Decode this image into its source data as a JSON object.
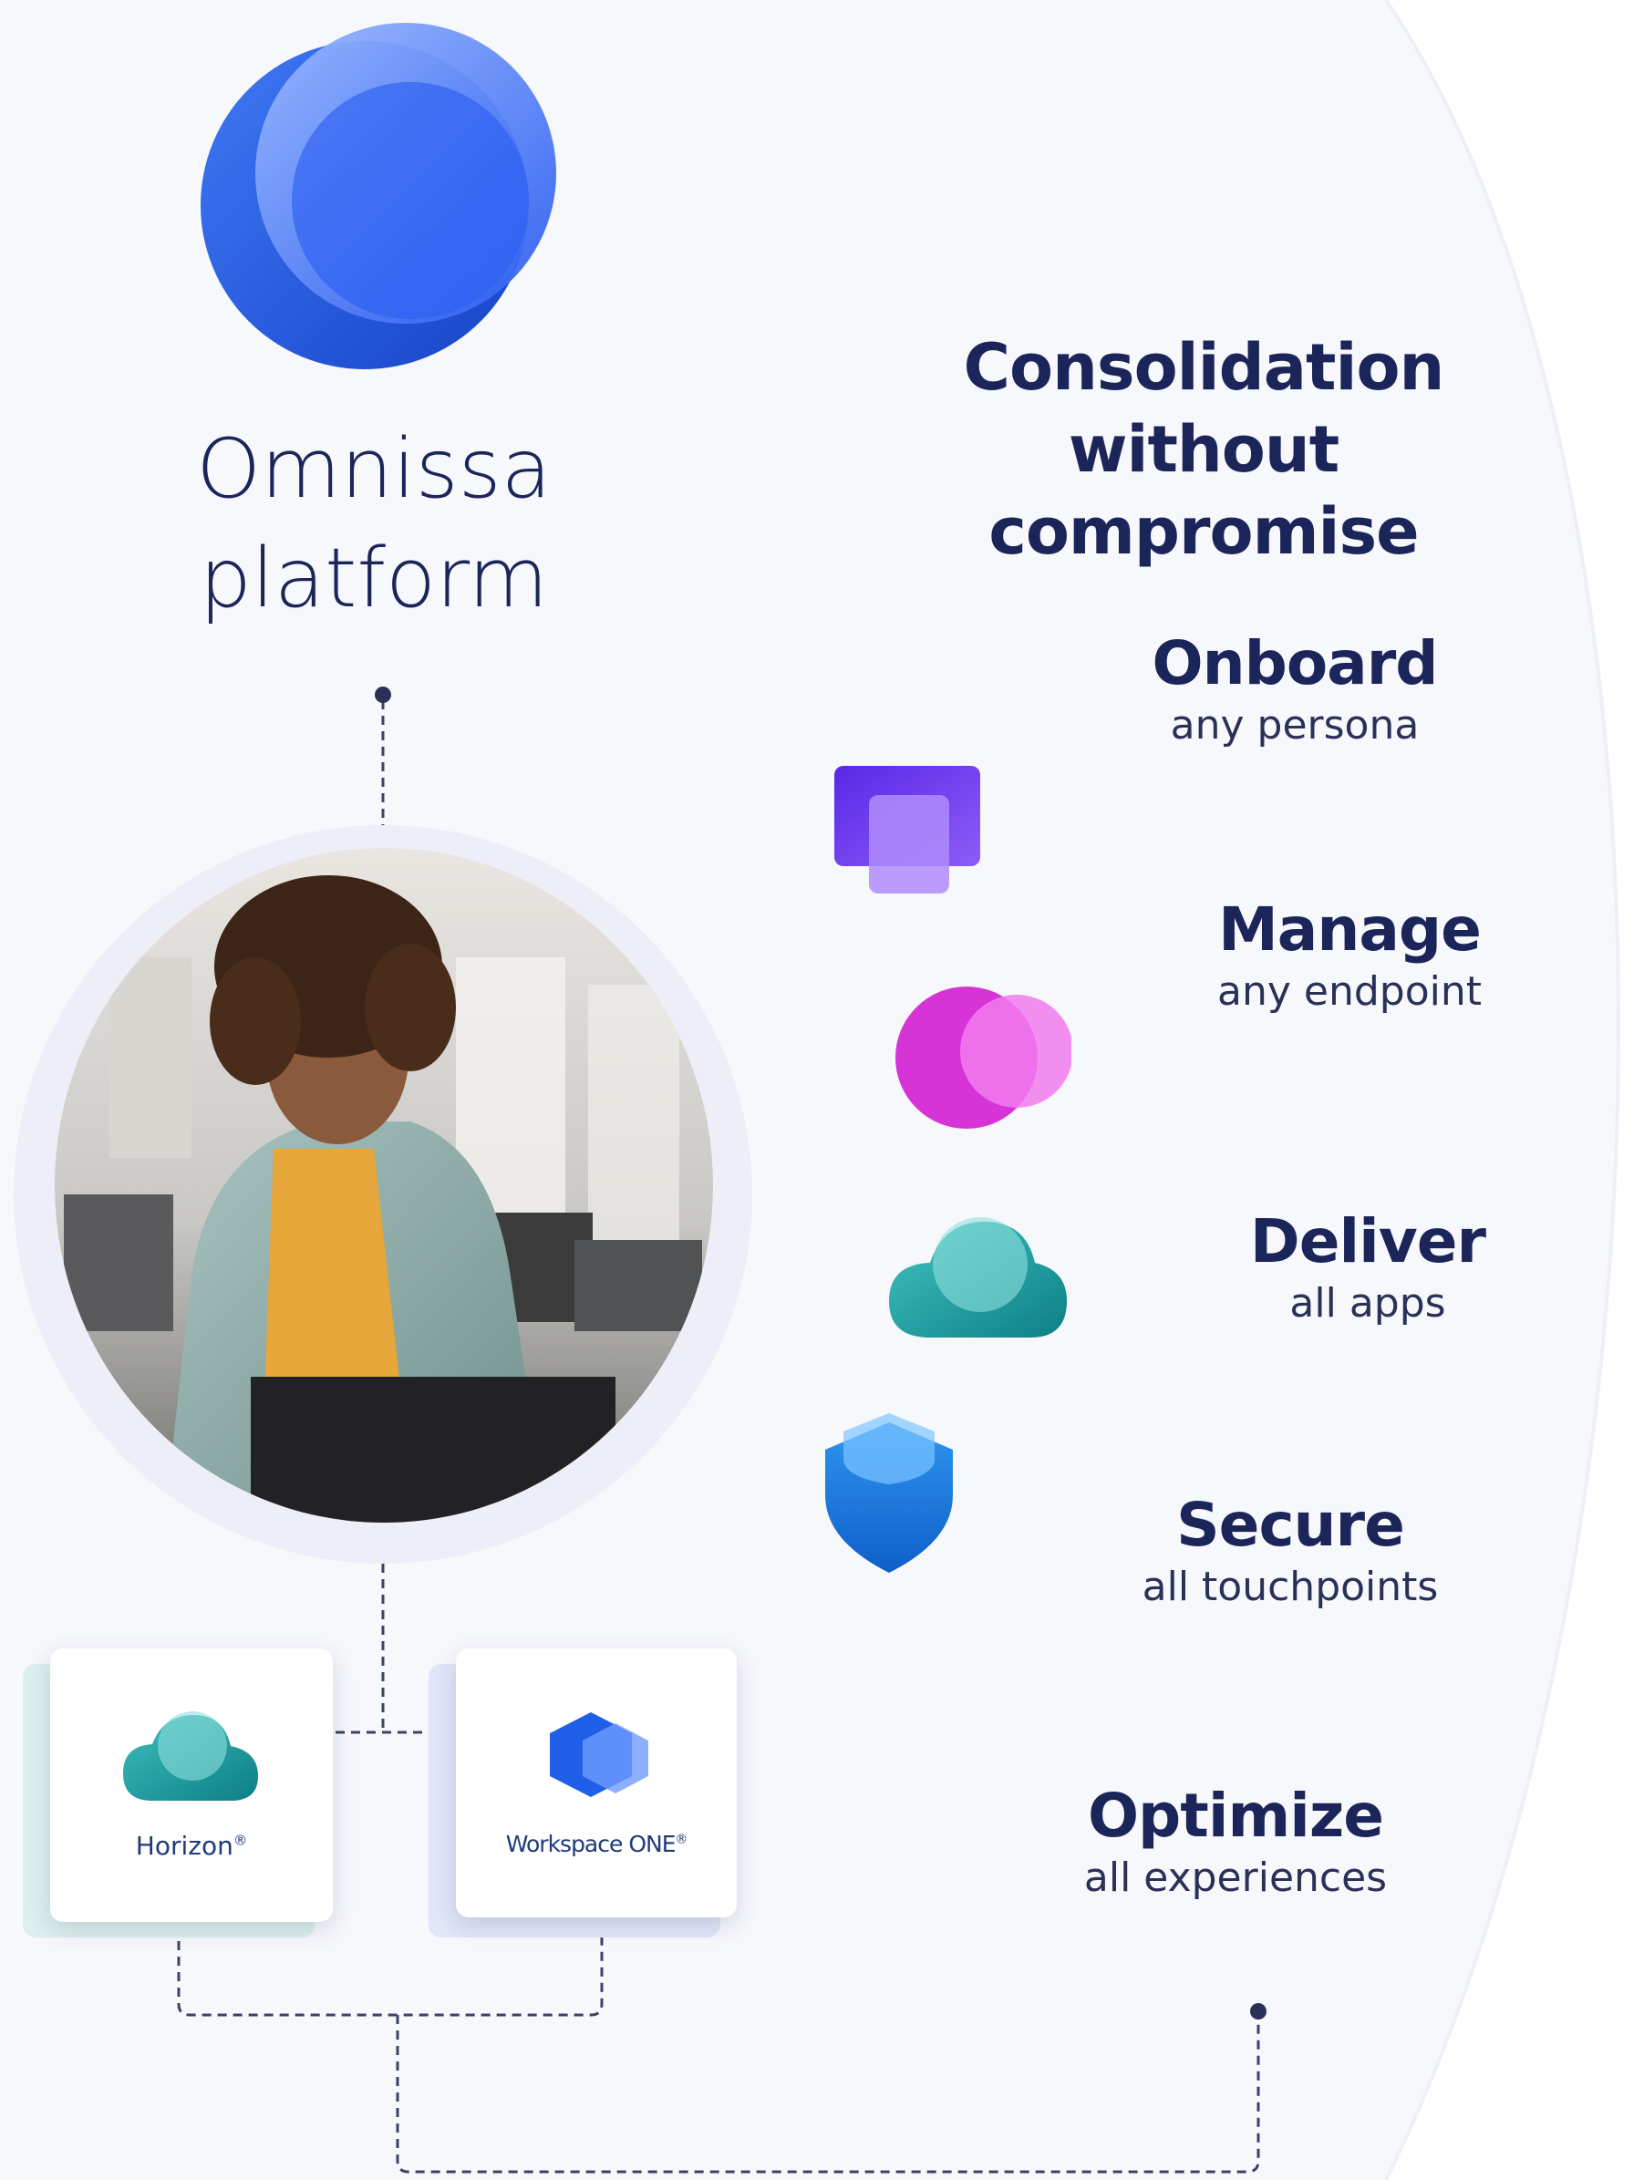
{
  "brand": {
    "title_line1": "Omnissa",
    "title_line2": "platform"
  },
  "headline": {
    "line1": "Consolidation",
    "line2": "without compromise"
  },
  "features": [
    {
      "title": "Onboard",
      "subtitle": "any persona",
      "icon": "stacked-squares-icon"
    },
    {
      "title": "Manage",
      "subtitle": "any endpoint",
      "icon": "overlapping-circles-icon"
    },
    {
      "title": "Deliver",
      "subtitle": "all apps",
      "icon": "cloud-icon"
    },
    {
      "title": "Secure",
      "subtitle": "all touchpoints",
      "icon": "shield-icon"
    },
    {
      "title": "Optimize",
      "subtitle": "all experiences",
      "icon": "none"
    }
  ],
  "products": [
    {
      "name": "Horizon",
      "mark": "®",
      "icon": "horizon-cloud-icon"
    },
    {
      "name": "Workspace ONE",
      "mark": "®",
      "icon": "workspace-one-hexagon-icon"
    }
  ],
  "photo": {
    "description_icon": "person-at-laptop-photo"
  },
  "colors": {
    "navy_text": "#1b2559",
    "brand_blue": "#2a5cf0",
    "violet": "#7a3cf5",
    "magenta": "#e040e0",
    "teal": "#1aa6a6",
    "shield_blue": "#1e7fe0",
    "connector": "#3a4366"
  }
}
